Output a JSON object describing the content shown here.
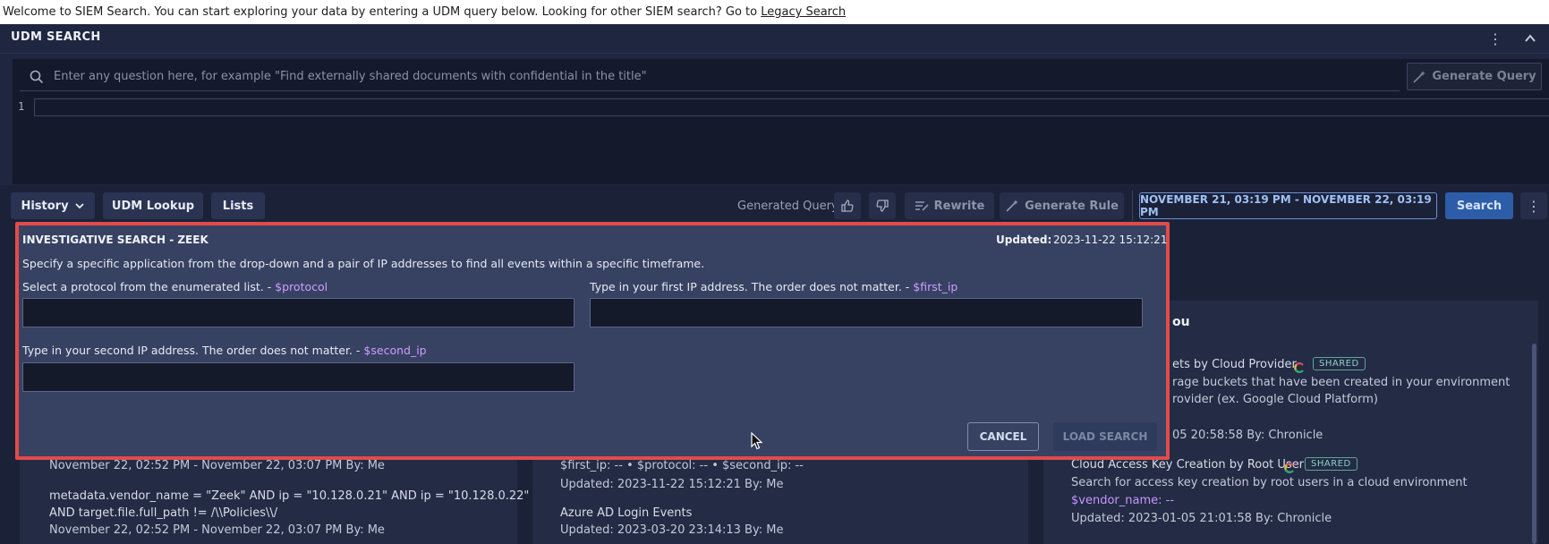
{
  "banner": {
    "text": "Welcome to SIEM Search. You can start exploring your data by entering a UDM query below. Looking for other SIEM search? Go to ",
    "link": "Legacy Search"
  },
  "udm": {
    "title": "UDM SEARCH",
    "question_placeholder": "Enter any question here, for example \"Find externally shared documents with confidential in the title\"",
    "generate_query": "Generate Query",
    "line_number": "1"
  },
  "toolbar": {
    "history": "History",
    "udm_lookup": "UDM Lookup",
    "lists": "Lists",
    "generated_query": "Generated Query",
    "rewrite": "Rewrite",
    "generate_rule": "Generate Rule",
    "time_range": "NOVEMBER 21, 03:19 PM - NOVEMBER 22, 03:19 PM",
    "search": "Search"
  },
  "modal": {
    "title": "INVESTIGATIVE SEARCH - ZEEK",
    "updated_label": "Updated:",
    "updated_value": "2023-11-22 15:12:21",
    "description": "Specify a specific application from the drop-down and a pair of IP addresses to find all events within a specific timeframe.",
    "protocol_label": "Select a protocol from the enumerated list. - ",
    "protocol_var": "$protocol",
    "first_ip_label": "Type in your first IP address. The order does not matter. - ",
    "first_ip_var": "$first_ip",
    "second_ip_label": "Type in your second IP address. The order does not matter. - ",
    "second_ip_var": "$second_ip",
    "protocol_value": "",
    "first_ip_value": "",
    "second_ip_value": "",
    "cancel": "CANCEL",
    "load_search": "LOAD SEARCH"
  },
  "background": {
    "left_card": {
      "partial_range": "November 22, 02:52 PM - November 22, 03:07 PM   By: Me",
      "query_line1": "metadata.vendor_name = \"Zeek\" AND ip = \"10.128.0.21\" AND ip = \"10.128.0.22\"",
      "query_line2": "AND target.file.full_path != /\\\\Policies\\\\/",
      "range": "November 22, 02:52 PM - November 22, 03:07 PM   By: Me"
    },
    "mid_card": {
      "partial_vars": "$first_ip: -- • $protocol: -- • $second_ip: --",
      "updated1": "Updated: 2023-11-22 15:12:21   By: Me",
      "item_title": "Azure AD Login Events",
      "updated2": "Updated: 2023-03-20 23:14:13   By: Me"
    },
    "right_card": {
      "heading_fragment": "ou",
      "item1_title_fragment": "ets by Cloud Provider",
      "badge": "SHARED",
      "item1_desc1_fragment": "rage buckets that have been created in your environment",
      "item1_desc2_fragment": "rovider (ex. Google Cloud Platform)",
      "item1_updated_fragment": "05 20:58:58   By: Chronicle",
      "item2_title": "Cloud Access Key Creation by Root User",
      "item2_desc": "Search for access key creation by root users in a cloud environment",
      "item2_var": "$vendor_name: --",
      "item2_updated": "Updated: 2023-01-05 21:01:58   By: Chronicle"
    }
  }
}
